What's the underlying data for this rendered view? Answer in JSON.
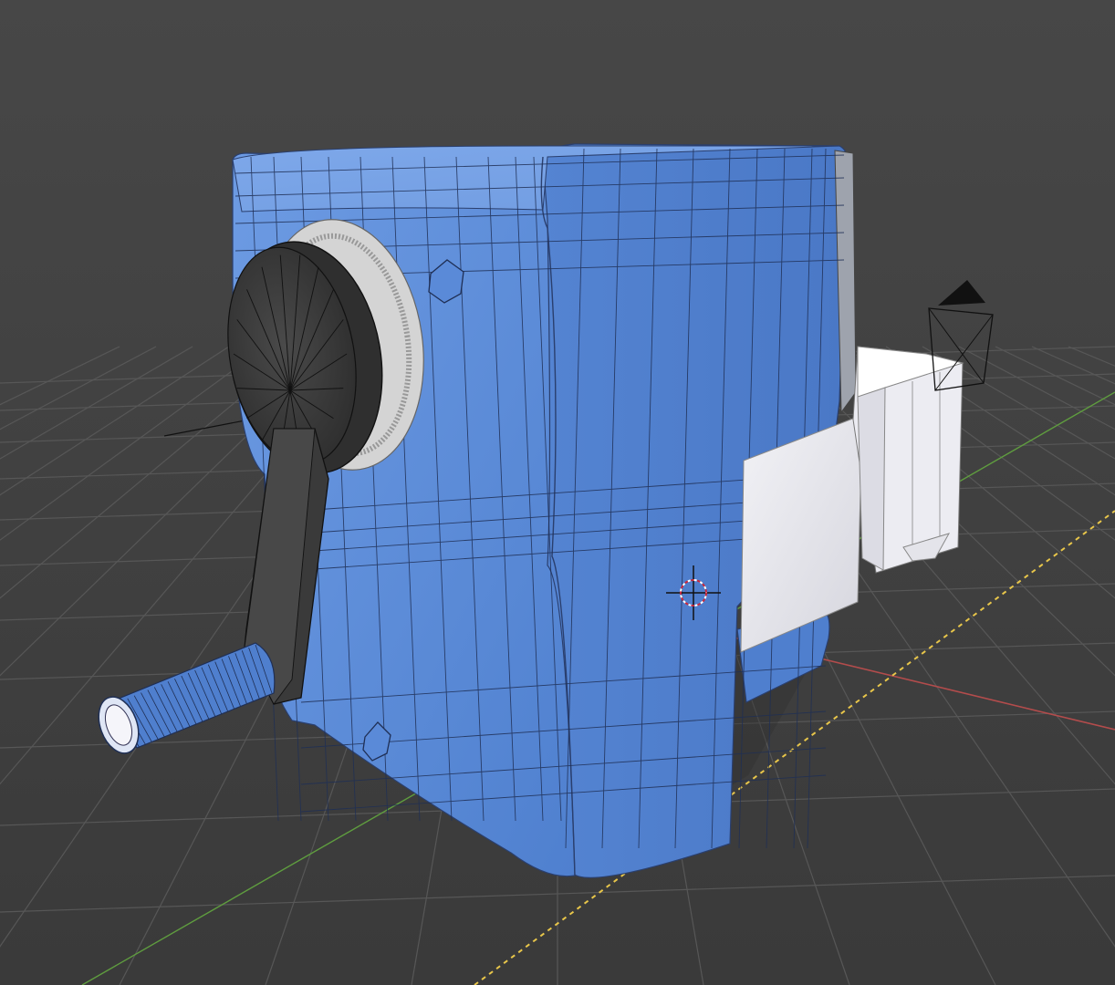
{
  "viewport": {
    "mode": "3d-viewport",
    "shading": "solid-with-wireframe",
    "background_color": "#3d3d3d",
    "grid_color": "#555555",
    "x_axis_color": "#b34c4c",
    "y_axis_color": "#5f9d3f",
    "camera_path_color": "#e8c64a"
  },
  "objects": [
    {
      "name": "sharpener-body",
      "color": "#5f8fdb"
    },
    {
      "name": "crank-disc",
      "color": "#3b3b3b"
    },
    {
      "name": "crank-handle",
      "color": "#3b3b3b"
    },
    {
      "name": "crank-grip",
      "color": "#5f8fdb"
    },
    {
      "name": "gear-ring",
      "color": "#cfcfcf"
    },
    {
      "name": "shavings-drawer",
      "color": "#e8e8ef"
    },
    {
      "name": "camera-gizmo",
      "color": "#111111"
    }
  ],
  "cursor": {
    "name": "3d-cursor",
    "color": "#c8283c"
  }
}
